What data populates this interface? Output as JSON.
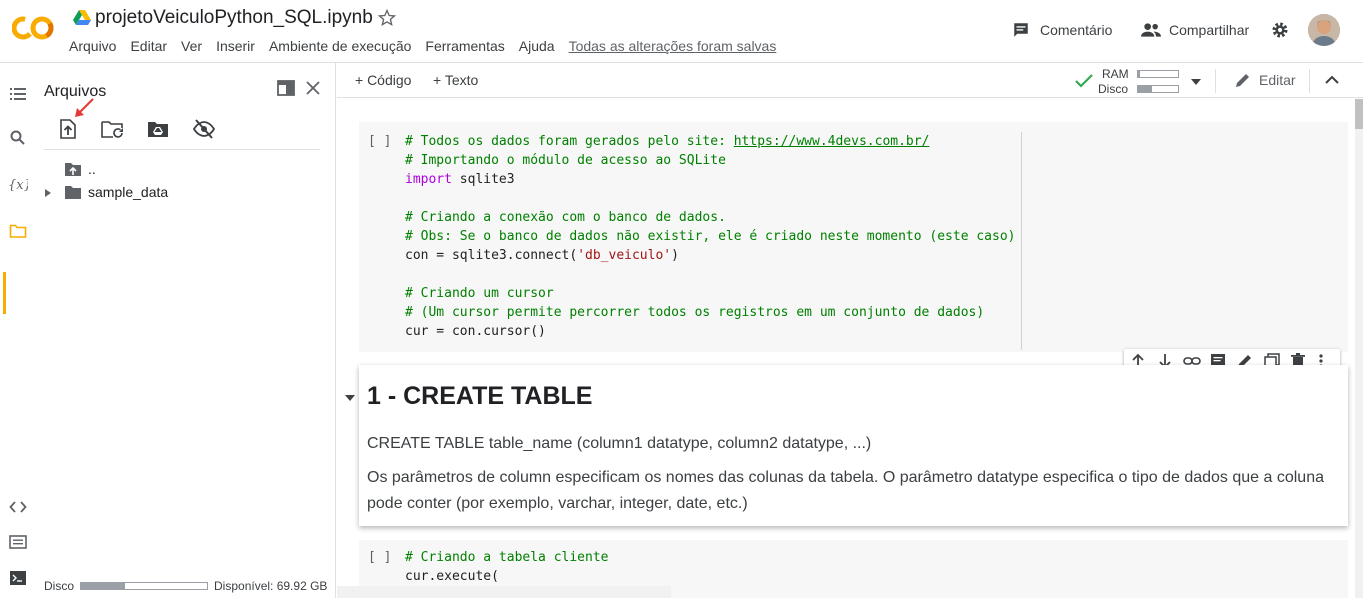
{
  "header": {
    "logo_text": "CO",
    "title": "projetoVeiculoPython_SQL.ipynb",
    "menu": [
      "Arquivo",
      "Editar",
      "Ver",
      "Inserir",
      "Ambiente de execução",
      "Ferramentas",
      "Ajuda"
    ],
    "saved_status": "Todas as alterações foram salvas",
    "comment_label": "Comentário",
    "share_label": "Compartilhar"
  },
  "files_panel": {
    "title": "Arquivos",
    "tree": {
      "parent_label": "..",
      "folder_label": "sample_data"
    },
    "footer": {
      "disk_label": "Disco",
      "disk_used_fraction": 0.35,
      "available_label": "Disponível: 69.92 GB"
    }
  },
  "toolbar": {
    "add_code_label": "+ Código",
    "add_text_label": "+ Texto",
    "ram_label": "RAM",
    "disk_label": "Disco",
    "ram_used_fraction": 0.05,
    "disk_used_fraction": 0.35,
    "edit_label": "Editar"
  },
  "cells": {
    "cell1": {
      "run_label": "[ ]",
      "lines": [
        {
          "segments": [
            {
              "t": "# Todos os dados foram gerados pelo site: ",
              "c": "c"
            },
            {
              "t": "https://www.4devs.com.br/",
              "c": "u"
            }
          ]
        },
        {
          "segments": [
            {
              "t": "# Importando o módulo de acesso ao SQLite",
              "c": "c"
            }
          ]
        },
        {
          "segments": [
            {
              "t": "import",
              "c": "k"
            },
            {
              "t": " sqlite3",
              "c": ""
            }
          ]
        },
        {
          "segments": [
            {
              "t": "",
              "c": ""
            }
          ]
        },
        {
          "segments": [
            {
              "t": "# Criando a conexão com o banco de dados.",
              "c": "c"
            }
          ]
        },
        {
          "segments": [
            {
              "t": "# Obs: Se o banco de dados não existir, ele é criado neste momento (este caso)",
              "c": "c"
            }
          ]
        },
        {
          "segments": [
            {
              "t": "con = sqlite3.connect(",
              "c": ""
            },
            {
              "t": "'db_veiculo'",
              "c": "s"
            },
            {
              "t": ")",
              "c": ""
            }
          ]
        },
        {
          "segments": [
            {
              "t": "",
              "c": ""
            }
          ]
        },
        {
          "segments": [
            {
              "t": "# Criando um cursor",
              "c": "c"
            }
          ]
        },
        {
          "segments": [
            {
              "t": "# (Um cursor permite percorrer todos os registros em um conjunto de dados)",
              "c": "c"
            }
          ]
        },
        {
          "segments": [
            {
              "t": "cur = con.cursor()",
              "c": ""
            }
          ]
        }
      ]
    },
    "text_cell": {
      "heading": "1 - CREATE TABLE",
      "p1": "CREATE TABLE table_name (column1 datatype, column2 datatype, ...)",
      "p2": "Os parâmetros de column especificam os nomes das colunas da tabela. O parâmetro datatype especifica o tipo de dados que a coluna pode conter (por exemplo, varchar, integer, date, etc.)"
    },
    "cell2": {
      "run_label": "[ ]",
      "lines": [
        {
          "segments": [
            {
              "t": "# Criando a tabela cliente",
              "c": "c"
            }
          ]
        },
        {
          "segments": [
            {
              "t": "cur.execute(",
              "c": ""
            }
          ]
        }
      ]
    }
  },
  "colors": {
    "accent": "#f9ab00",
    "comment": "#008000",
    "keyword": "#af00db",
    "string": "#a31515",
    "red_arrow": "#e53935"
  }
}
